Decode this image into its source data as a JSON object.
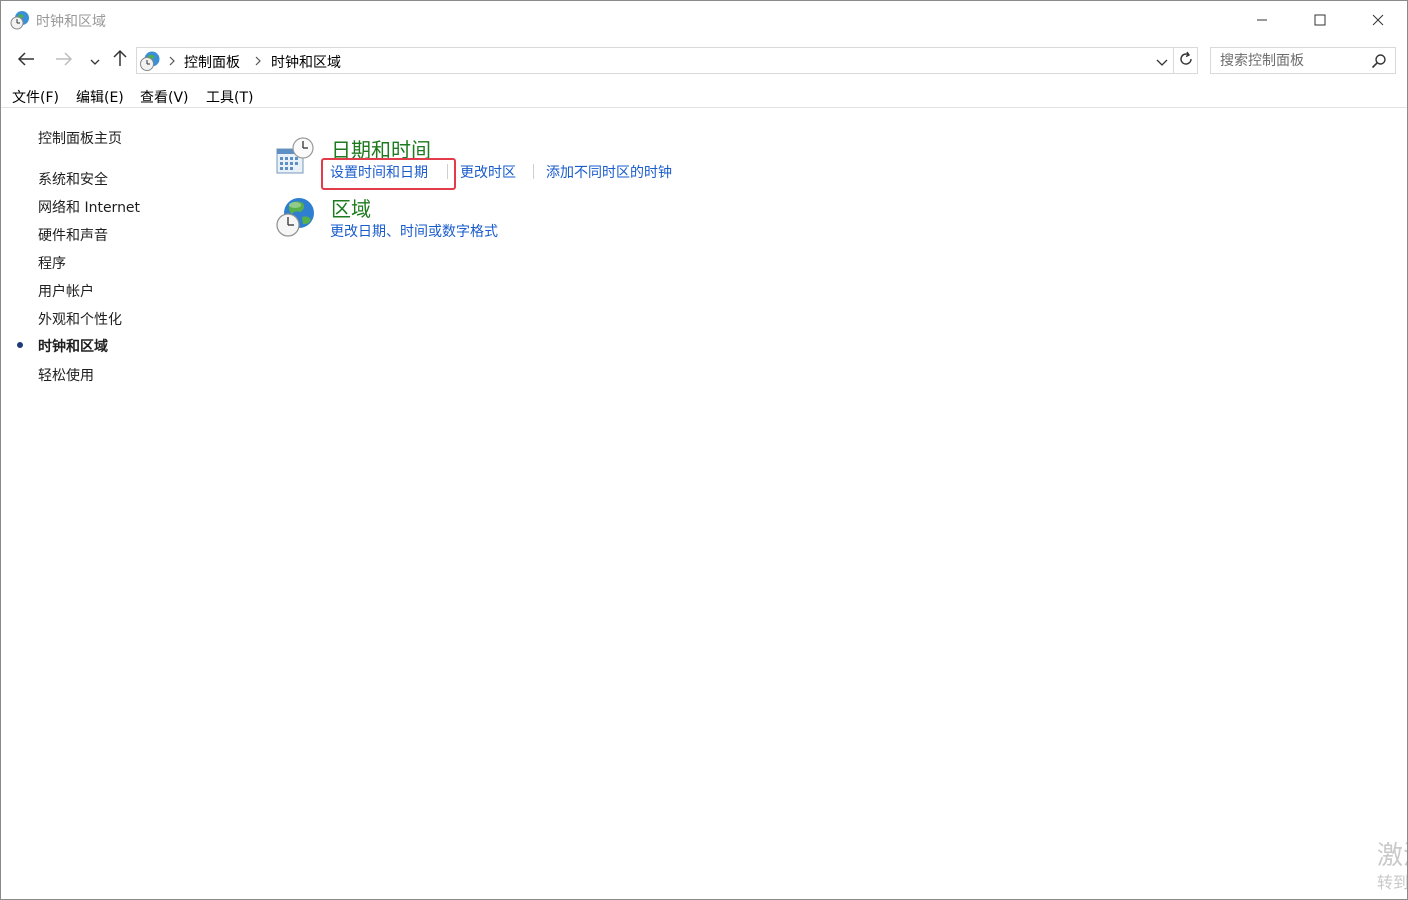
{
  "window": {
    "title": "时钟和区域",
    "icons": {
      "app": "clock-globe-icon",
      "minimize": "minimize-icon",
      "maximize": "maximize-icon",
      "close": "close-icon"
    }
  },
  "nav": {
    "icons": {
      "back": "arrow-left-icon",
      "forward": "arrow-right-icon",
      "recent": "chevron-down-icon",
      "up": "arrow-up-icon",
      "refresh": "refresh-icon"
    }
  },
  "address": {
    "breadcrumbs": [
      "控制面板",
      "时钟和区域"
    ],
    "icons": {
      "location": "clock-globe-icon",
      "separator": "chevron-right-icon",
      "dropdown": "chevron-down-icon"
    }
  },
  "search": {
    "placeholder": "搜索控制面板",
    "value": "",
    "icon": "search-icon"
  },
  "menubar": {
    "items": [
      "文件(F)",
      "编辑(E)",
      "查看(V)",
      "工具(T)"
    ]
  },
  "sidebar": {
    "home": "控制面板主页",
    "items": [
      "系统和安全",
      "网络和 Internet",
      "硬件和声音",
      "程序",
      "用户帐户",
      "外观和个性化",
      "时钟和区域",
      "轻松使用"
    ],
    "active_index": 6
  },
  "categories": [
    {
      "title": "日期和时间",
      "icon": "calendar-clock-icon",
      "links": [
        "设置时间和日期",
        "更改时区",
        "添加不同时区的时钟"
      ]
    },
    {
      "title": "区域",
      "icon": "globe-clock-icon",
      "links": [
        "更改日期、时间或数字格式"
      ]
    }
  ],
  "colors": {
    "category_title": "#1e7a1e",
    "link": "#1a5ccc",
    "highlight_border": "#e23b49",
    "active_bullet": "#1e3a78"
  },
  "watermark": {
    "line1": "激活",
    "line2": "转到"
  }
}
